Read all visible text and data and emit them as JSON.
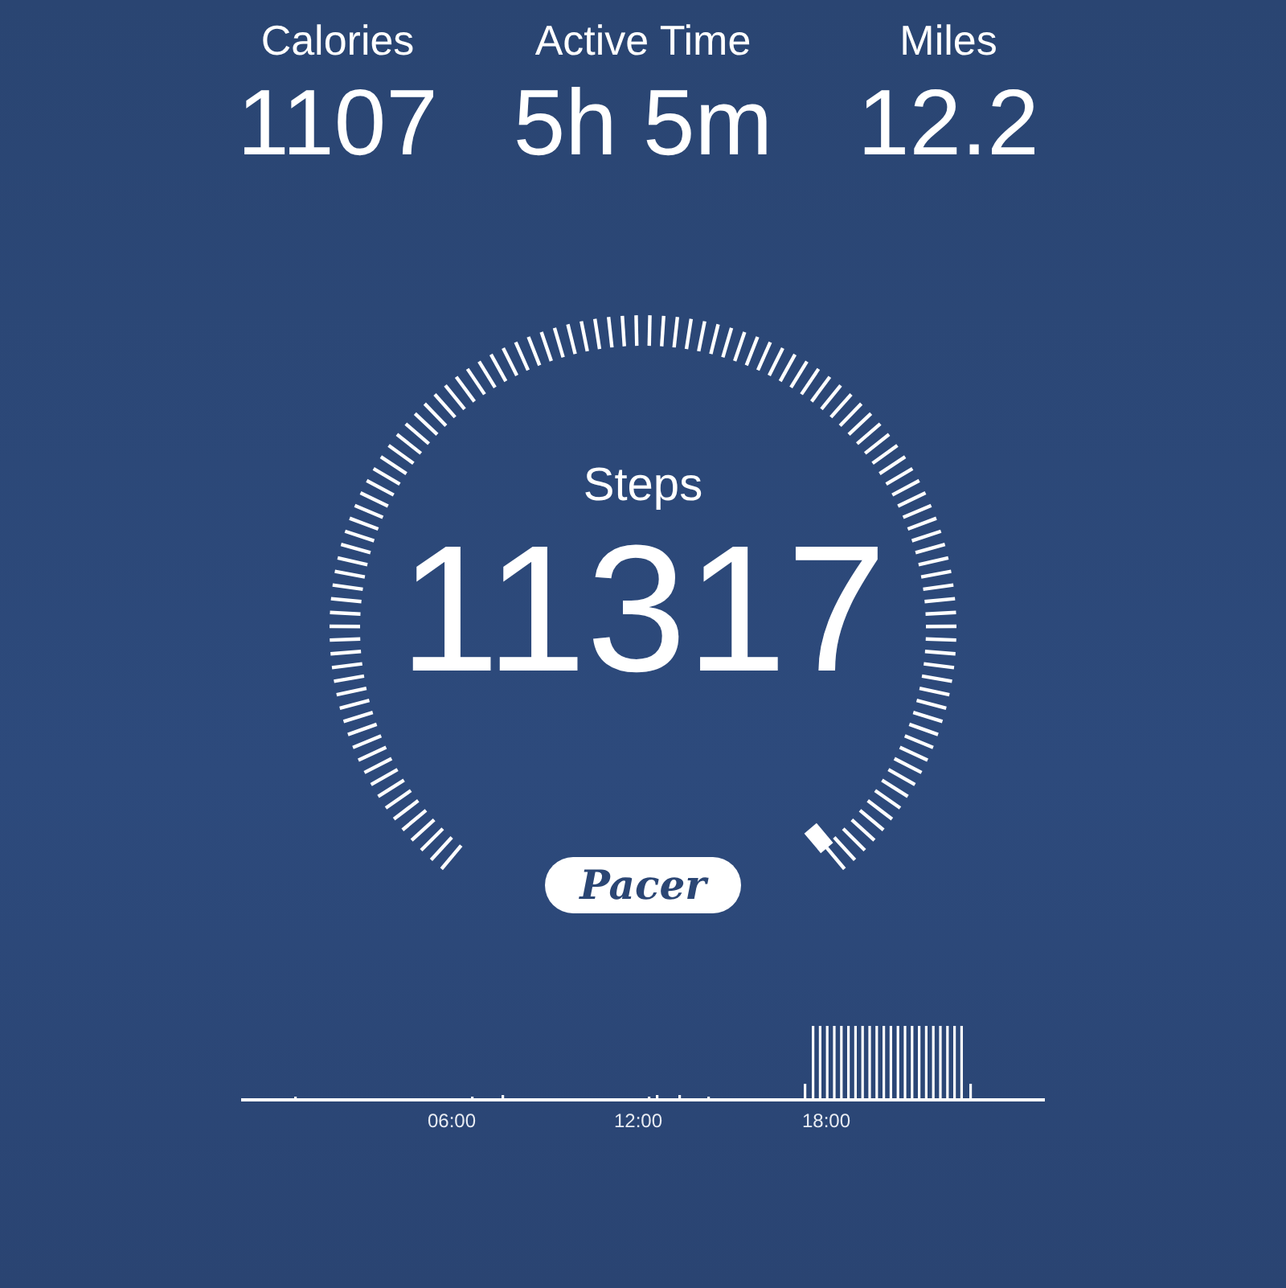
{
  "stats": [
    {
      "label": "Calories",
      "value": "1107"
    },
    {
      "label": "Active Time",
      "value": "5h 5m"
    },
    {
      "label": "Miles",
      "value": "12.2"
    }
  ],
  "steps": {
    "label": "Steps",
    "value": "11317"
  },
  "logo": "Pacer",
  "timeline": {
    "labels": [
      "06:00",
      "12:00",
      "18:00"
    ]
  }
}
